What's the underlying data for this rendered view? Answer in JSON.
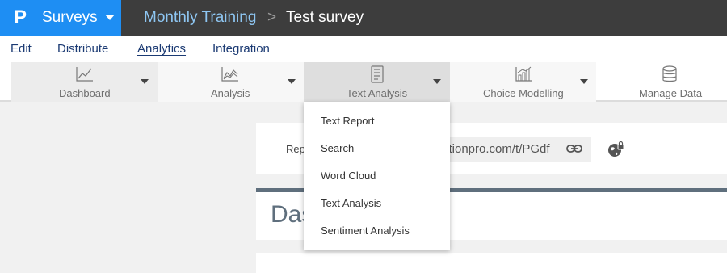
{
  "brand": {
    "logo": "P",
    "name": "Surveys"
  },
  "breadcrumb": {
    "parent": "Monthly Training",
    "separator": ">",
    "current": "Test survey"
  },
  "menu": {
    "edit": "Edit",
    "distribute": "Distribute",
    "analytics": "Analytics",
    "integration": "Integration"
  },
  "toolbar": {
    "dashboard": "Dashboard",
    "analysis": "Analysis",
    "text_analysis": "Text Analysis",
    "choice_modelling": "Choice Modelling",
    "manage_data": "Manage Data"
  },
  "dropdown": {
    "items": [
      "Text Report",
      "Search",
      "Word Cloud",
      "Text Analysis",
      "Sentiment Analysis"
    ]
  },
  "report_link": {
    "label": "Rep",
    "url": "stionpro.com/t/PGdf"
  },
  "dashboard_heading": "Das",
  "colors": {
    "brand": "#1e8ef3",
    "topbar": "#3d3d3d",
    "menu_text": "#1b3a73",
    "heading": "#5f6f7d"
  }
}
